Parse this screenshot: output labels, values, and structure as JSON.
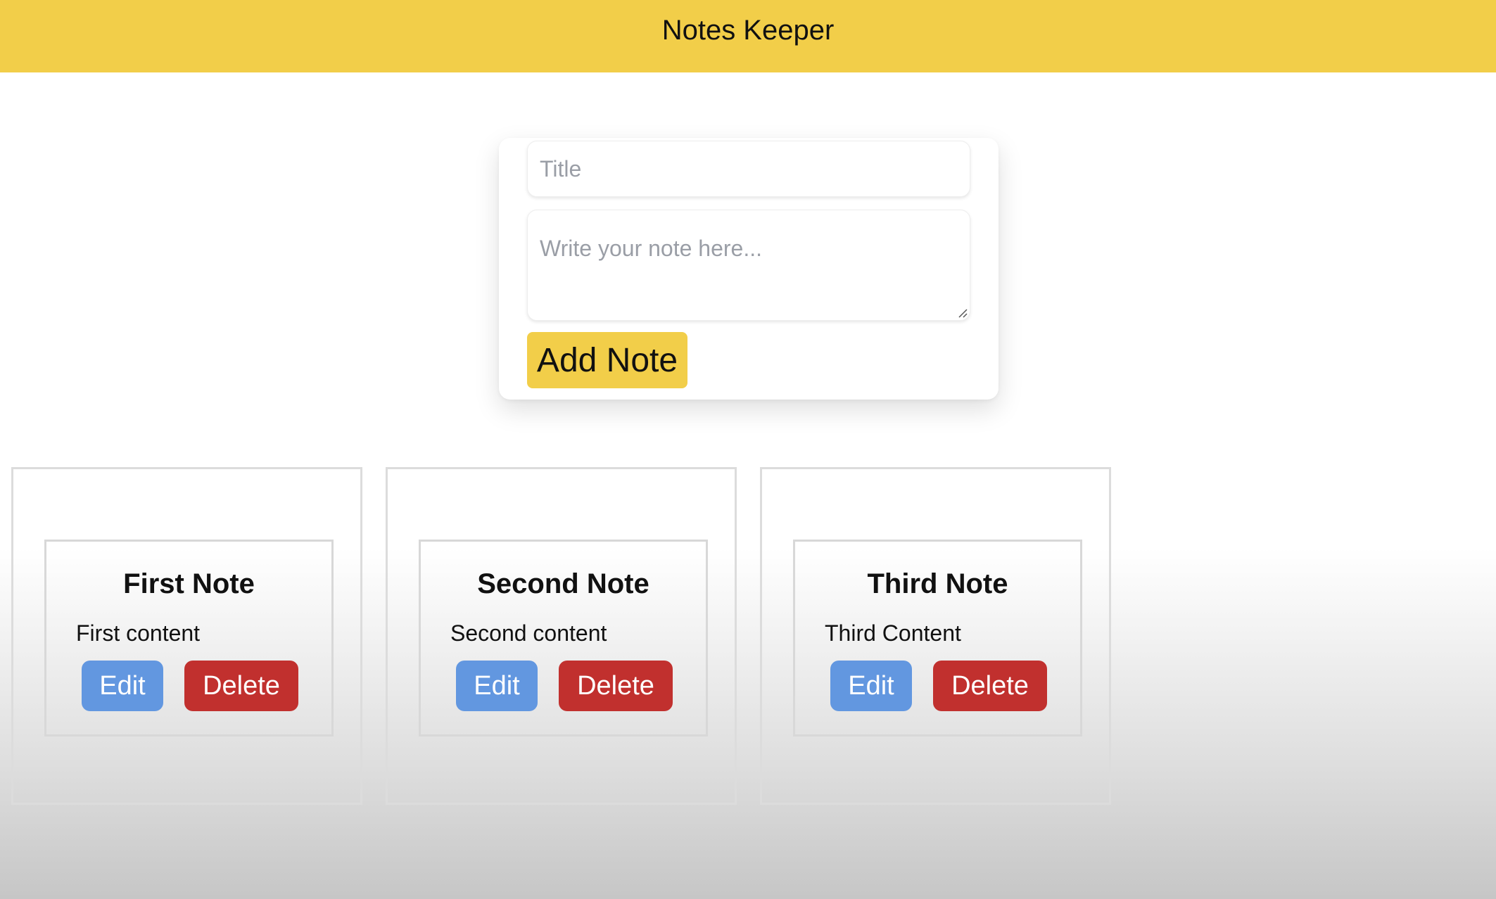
{
  "header": {
    "title": "Notes Keeper"
  },
  "form": {
    "title_placeholder": "Title",
    "title_value": "",
    "content_placeholder": "Write your note here...",
    "content_value": "",
    "add_label": "Add Note"
  },
  "notes": [
    {
      "title": "First Note",
      "content": "First content",
      "edit_label": "Edit",
      "delete_label": "Delete"
    },
    {
      "title": "Second Note",
      "content": "Second content",
      "edit_label": "Edit",
      "delete_label": "Delete"
    },
    {
      "title": "Third Note",
      "content": "Third Content",
      "edit_label": "Edit",
      "delete_label": "Delete"
    }
  ],
  "colors": {
    "header_bg": "#f2ce49",
    "add_button": "#f2ce49",
    "edit_button": "#6297e0",
    "delete_button": "#c1302e"
  }
}
